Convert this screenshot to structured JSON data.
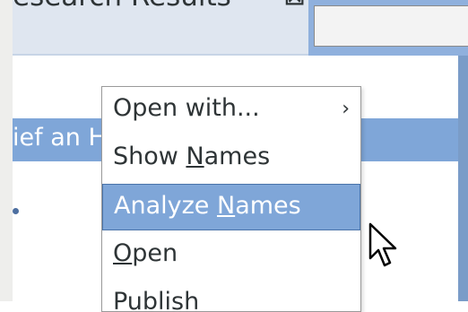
{
  "tab": {
    "title": "esearch Results",
    "close_glyph": "⊠"
  },
  "result_row": {
    "text": "ief an Herder"
  },
  "context_menu": {
    "items": [
      {
        "label": "Open with...",
        "submenu_arrow": "›"
      },
      {
        "label_pre": "Show ",
        "label_accel": "N",
        "label_post": "ames"
      },
      {
        "label_pre": "Analyze ",
        "label_accel": "N",
        "label_post": "ames"
      },
      {
        "label_pre": "",
        "label_accel": "O",
        "label_post": "pen"
      },
      {
        "label": "Publish"
      }
    ]
  },
  "colors": {
    "selection": "#7fa6d8",
    "tab_strip": "#c7d4e6",
    "toolbar": "#8fb0dd"
  },
  "icons": {
    "close": "close-icon",
    "submenu": "chevron-right-icon",
    "cursor": "mouse-pointer-icon"
  }
}
